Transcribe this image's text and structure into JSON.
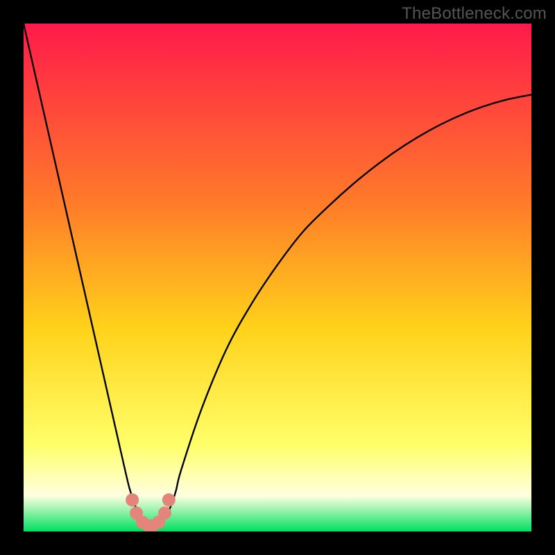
{
  "watermark": "TheBottleneck.com",
  "colors": {
    "gradient_top": "#ff1a4b",
    "gradient_mid1": "#ff7a2a",
    "gradient_mid2": "#ffd21a",
    "gradient_mid3": "#ffff6a",
    "gradient_mid4": "#ffffe0",
    "gradient_bottom": "#00e060",
    "curve": "#000000",
    "marker_fill": "#e4857c",
    "marker_stroke": "#d86a60"
  },
  "chart_data": {
    "type": "line",
    "title": "",
    "xlabel": "",
    "ylabel": "",
    "xlim": [
      0,
      100
    ],
    "ylim": [
      0,
      100
    ],
    "grid": false,
    "series": [
      {
        "name": "bottleneck-curve",
        "x": [
          0,
          5,
          10,
          15,
          20,
          21,
          22,
          23,
          24,
          25,
          26,
          27,
          28,
          29,
          30,
          31,
          35,
          40,
          45,
          50,
          55,
          60,
          65,
          70,
          75,
          80,
          85,
          90,
          95,
          100
        ],
        "y": [
          100,
          78,
          56,
          34,
          12,
          8,
          5,
          3,
          1.7,
          1.0,
          1.0,
          1.7,
          3,
          5,
          8,
          12,
          24,
          36,
          45,
          52.5,
          59,
          64,
          68.5,
          72.5,
          76,
          79,
          81.5,
          83.5,
          85,
          86
        ]
      }
    ],
    "markers": {
      "name": "highlighted-points",
      "x": [
        21.4,
        22.2,
        23.4,
        24.6,
        25.4,
        26.6,
        27.8,
        28.6
      ],
      "y": [
        6.2,
        3.6,
        1.8,
        1.1,
        1.1,
        1.8,
        3.6,
        6.2
      ]
    }
  }
}
